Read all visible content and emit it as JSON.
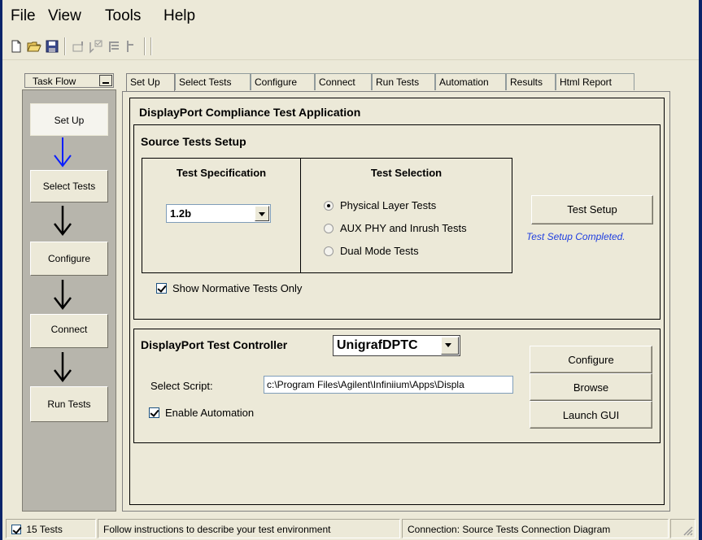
{
  "menu": {
    "file": "File",
    "view": "View",
    "tools": "Tools",
    "help": "Help"
  },
  "toolbar": {
    "icons": [
      "new-file-icon",
      "open-folder-icon",
      "save-icon",
      "checkbox-list-icon",
      "pointer-check-icon",
      "align-icon",
      "flag-icon"
    ]
  },
  "task_flow": {
    "header": "Task Flow",
    "steps": [
      {
        "label": "Set Up",
        "active": true
      },
      {
        "label": "Select Tests"
      },
      {
        "label": "Configure"
      },
      {
        "label": "Connect"
      },
      {
        "label": "Run Tests"
      }
    ]
  },
  "tabs": [
    "Set Up",
    "Select Tests",
    "Configure",
    "Connect",
    "Run Tests",
    "Automation",
    "Results",
    "Html Report"
  ],
  "app_title": "DisplayPort Compliance Test Application",
  "source_setup": {
    "title": "Source Tests Setup",
    "spec_header": "Test Specification",
    "spec_value": "1.2b",
    "selection_header": "Test Selection",
    "options": [
      {
        "label": "Physical Layer Tests",
        "selected": true
      },
      {
        "label": "AUX PHY and Inrush Tests",
        "selected": false
      },
      {
        "label": "Dual Mode Tests",
        "selected": false
      }
    ],
    "setup_button": "Test Setup",
    "status": "Test Setup Completed.",
    "normative_label": "Show Normative Tests Only",
    "normative_checked": true
  },
  "controller": {
    "title": "DisplayPort Test Controller",
    "value": "UnigrafDPTC",
    "script_label": "Select Script:",
    "script_path": "c:\\Program Files\\Agilent\\Infiniium\\Apps\\Displa",
    "buttons": {
      "configure": "Configure",
      "browse": "Browse",
      "launch": "Launch GUI"
    },
    "automation_label": "Enable Automation",
    "automation_checked": true
  },
  "statusbar": {
    "tests": "15 Tests",
    "tests_checked": true,
    "message": "Follow instructions to describe your test environment",
    "connection": "Connection: Source Tests Connection Diagram"
  },
  "colors": {
    "active_arrow": "#0A1EFF",
    "status_text": "#1F3EE0",
    "taskflow_bg": "#B7B5AC",
    "window_bg": "#ECE9D8"
  }
}
